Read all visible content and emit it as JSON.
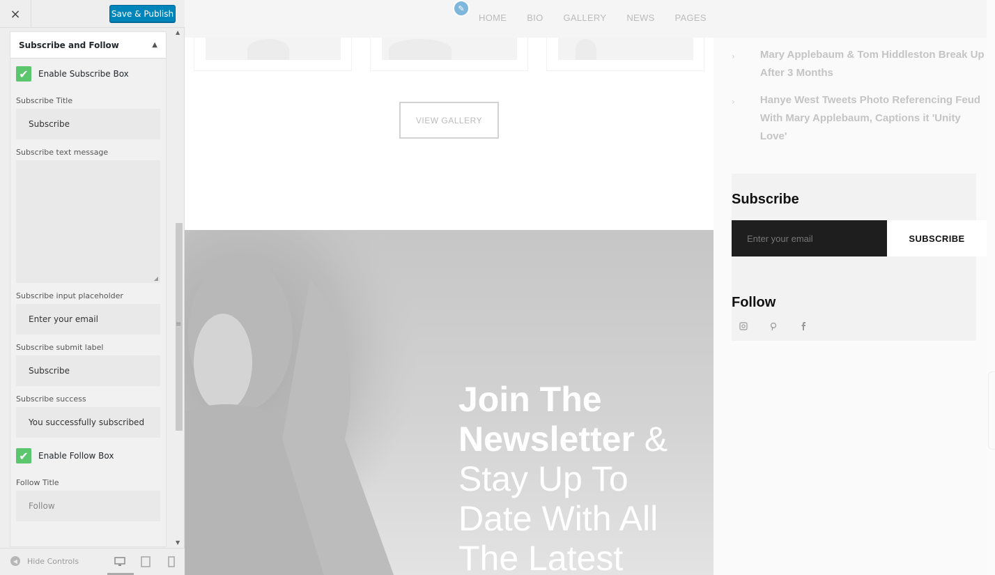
{
  "customizer": {
    "close_icon": "×",
    "save_label": "Save & Publish",
    "section_title": "Subscribe and Follow",
    "enable_subscribe_label": "Enable Subscribe Box",
    "subscribe_title_label": "Subscribe Title",
    "subscribe_title_value": "Subscribe",
    "subscribe_text_label": "Subscribe text message",
    "subscribe_text_value": "",
    "placeholder_label": "Subscribe input placeholder",
    "placeholder_value": "Enter your email",
    "submit_label_label": "Subscribe submit label",
    "submit_label_value": "Subscribe",
    "success_label": "Subscribe success",
    "success_value": "You successfully subscribed",
    "enable_follow_label": "Enable Follow Box",
    "follow_title_label": "Follow Title",
    "follow_title_value": "Follow",
    "hide_controls_label": "Hide Controls",
    "enable_subscribe_checked": true,
    "enable_follow_checked": true,
    "accent_color": "#0085ba",
    "check_color": "#5cc66e"
  },
  "site": {
    "nav": [
      "HOME",
      "BIO",
      "GALLERY",
      "NEWS",
      "PAGES"
    ],
    "view_gallery_label": "VIEW GALLERY",
    "hero": {
      "bold_line": "Join The Newsletter",
      "rest": "& Stay Up To Date With All The Latest"
    },
    "news": [
      "Mary Applebaum & Tom Hiddleston Break Up After 3 Months",
      "Hanye West Tweets Photo Referencing Feud With Mary Applebaum, Captions it 'Unity Love'"
    ],
    "subscribe": {
      "title": "Subscribe",
      "placeholder": "Enter your email",
      "button": "SUBSCRIBE"
    },
    "follow": {
      "title": "Follow",
      "icons": [
        "instagram-icon",
        "pinterest-icon",
        "facebook-icon"
      ]
    }
  }
}
